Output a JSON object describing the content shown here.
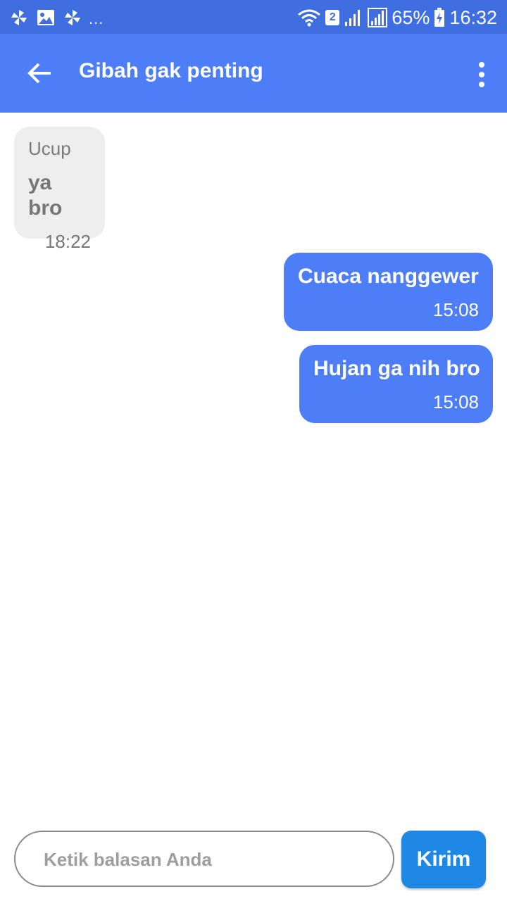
{
  "status_bar": {
    "left_icons": [
      "pinwheel-icon",
      "image-icon",
      "pinwheel-icon"
    ],
    "overflow": "...",
    "sim_number": "2",
    "battery": "65%",
    "time": "16:32",
    "background": "#3f6ee0"
  },
  "app_bar": {
    "title": "Gibah gak penting",
    "back_icon": "arrow-left-icon",
    "menu_icon": "more-vertical-icon",
    "background": "#4d7ef7"
  },
  "messages": [
    {
      "direction": "incoming",
      "sender": "Ucup",
      "text": "ya bro",
      "time": "18:22"
    },
    {
      "direction": "outgoing",
      "text": "Cuaca nanggewer",
      "time": "15:08"
    },
    {
      "direction": "outgoing",
      "text": "Hujan ga nih bro",
      "time": "15:08"
    }
  ],
  "composer": {
    "placeholder": "Ketik balasan Anda",
    "value": "",
    "send_label": "Kirim",
    "send_color": "#1f88e5"
  }
}
